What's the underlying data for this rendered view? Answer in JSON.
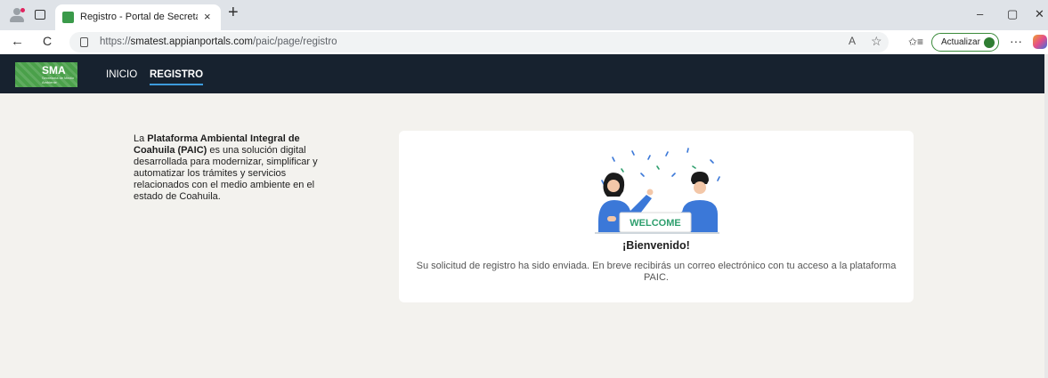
{
  "browser": {
    "tab_title": "Registro - Portal de Secretaría de",
    "tab_close": "×",
    "new_tab": "+",
    "url_scheme": "https://",
    "url_host": "smatest.appianportals.com",
    "url_path": "/paic/page/registro",
    "update_label": "Actualizar",
    "more": "···",
    "back": "←",
    "reload": "C",
    "minimize": "–",
    "restore": "▢",
    "close": "✕",
    "read_aloud": "A",
    "favorite": "☆",
    "favorites": "✩≡"
  },
  "app": {
    "logo_text": "SMA",
    "logo_sub": "Secretaría de Medio Ambiente",
    "nav": {
      "inicio": "INICIO",
      "registro": "REGISTRO"
    }
  },
  "intro": {
    "prefix": "La ",
    "bold": "Plataforma Ambiental Integral de Coahuila (PAIC)",
    "suffix": " es una solución digital desarrollada para modernizar, simplificar y automatizar los trámites y servicios relacionados con el medio ambiente en el estado de Coahuila."
  },
  "card": {
    "sign_text": "WELCOME",
    "title": "¡Bienvenido!",
    "message": "Su solicitud de registro ha sido enviada. En breve recibirás un correo electrónico con tu acceso a la plataforma PAIC."
  },
  "colors": {
    "header_bg": "#17222f",
    "accent_blue": "#3d9bdc",
    "logo_green": "#4aa04a",
    "welcome_green": "#2e9f6e",
    "page_bg": "#f3f2ee"
  }
}
